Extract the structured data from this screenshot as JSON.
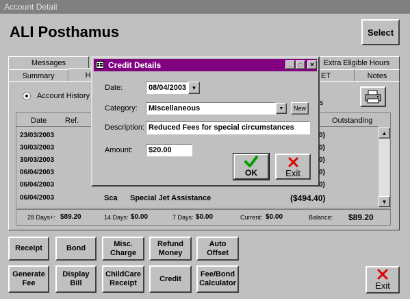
{
  "window": {
    "title": "Account Detail"
  },
  "account": {
    "name": "ALI Posthamus"
  },
  "select_label": "Select",
  "tabs_back": [
    "Messages",
    "Extra Eligible Hours"
  ],
  "tabs_front": [
    "Summary",
    "Hi",
    "ET",
    "Notes"
  ],
  "history": {
    "radio_label": "Account History",
    "right_fragment": "s",
    "columns": [
      "Date",
      "Ref.",
      "Outstanding"
    ],
    "rows": [
      {
        "date": "23/03/2003",
        "ref": "",
        "desc": "",
        "amount": "0)"
      },
      {
        "date": "30/03/2003",
        "ref": "",
        "desc": "",
        "amount": "0)"
      },
      {
        "date": "30/03/2003",
        "ref": "",
        "desc": "",
        "amount": "0)"
      },
      {
        "date": "06/04/2003",
        "ref": "",
        "desc": "",
        "amount": "0)"
      },
      {
        "date": "06/04/2003",
        "ref": "",
        "desc": "",
        "amount": "0)"
      },
      {
        "date": "06/04/2003",
        "ref": "Sca",
        "desc": "Special Jet Assistance",
        "amount": "($494.40)"
      }
    ],
    "totals": {
      "days28_label": "28 Days+:",
      "days28": "$89.20",
      "days14_label": "14 Days:",
      "days14": "$0.00",
      "days7_label": "7 Days:",
      "days7": "$0.00",
      "current_label": "Current:",
      "current": "$0.00",
      "balance_label": "Balance:",
      "balance": "$89.20"
    }
  },
  "dialog": {
    "title": "Credit Details",
    "date_label": "Date:",
    "date_value": "08/04/2003",
    "category_label": "Category:",
    "category_value": "Miscellaneous",
    "new_label": "New",
    "description_label": "Description:",
    "description_value": "Reduced Fees for special circumstances",
    "amount_label": "Amount:",
    "amount_value": "$20.00",
    "ok_label": "OK",
    "exit_label": "Exit"
  },
  "actions_row1": [
    "Receipt",
    "Bond",
    "Misc.\nCharge",
    "Refund\nMoney",
    "Auto\nOffset"
  ],
  "actions_row2": [
    "Generate\nFee",
    "Display\nBill",
    "ChildCare\nReceipt",
    "Credit",
    "Fee/Bond\nCalculator"
  ],
  "exit_label": "Exit",
  "colors": {
    "dialog_title": "#800080",
    "ok_check": "#00a000",
    "exit_x": "#e00000"
  }
}
